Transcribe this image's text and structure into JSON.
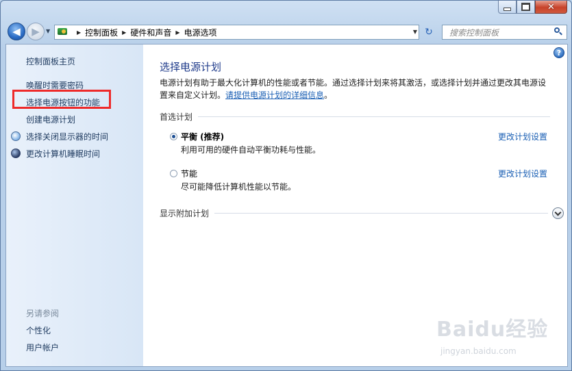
{
  "window": {
    "caption": {
      "minimize": "–",
      "maximize": "□",
      "close": "✕"
    }
  },
  "toolbar": {
    "breadcrumbs": [
      "控制面板",
      "硬件和声音",
      "电源选项"
    ],
    "search_placeholder": "搜索控制面板"
  },
  "sidebar": {
    "items": [
      {
        "label": "控制面板主页"
      },
      {
        "label": "唤醒时需要密码"
      },
      {
        "label": "选择电源按钮的功能"
      },
      {
        "label": "创建电源计划"
      },
      {
        "label": "选择关闭显示器的时间",
        "icon": "clock-icon"
      },
      {
        "label": "更改计算机睡眠时间",
        "icon": "moon-icon"
      }
    ],
    "see_also_title": "另请参阅",
    "see_also": [
      {
        "label": "个性化"
      },
      {
        "label": "用户帐户"
      }
    ]
  },
  "main": {
    "title": "选择电源计划",
    "description": "电源计划有助于最大化计算机的性能或者节能。通过选择计划来将其激活，或选择计划并通过更改其电源设置来自定义计划。",
    "detail_link": "请提供电源计划的详细信息",
    "description_end": "。",
    "preferred_heading": "首选计划",
    "plans": [
      {
        "name": "平衡 (推荐)",
        "desc": "利用可用的硬件自动平衡功耗与性能。",
        "link": "更改计划设置",
        "selected": true
      },
      {
        "name": "节能",
        "desc": "尽可能降低计算机性能以节能。",
        "link": "更改计划设置",
        "selected": false
      }
    ],
    "more_plans": "显示附加计划",
    "help": "?"
  },
  "watermark": {
    "text": "Baidu经验",
    "sub": "jingyan.baidu.com"
  },
  "colors": {
    "highlight": "#ee2a2a",
    "link": "#1a5fb4",
    "title": "#1e3a8a"
  }
}
